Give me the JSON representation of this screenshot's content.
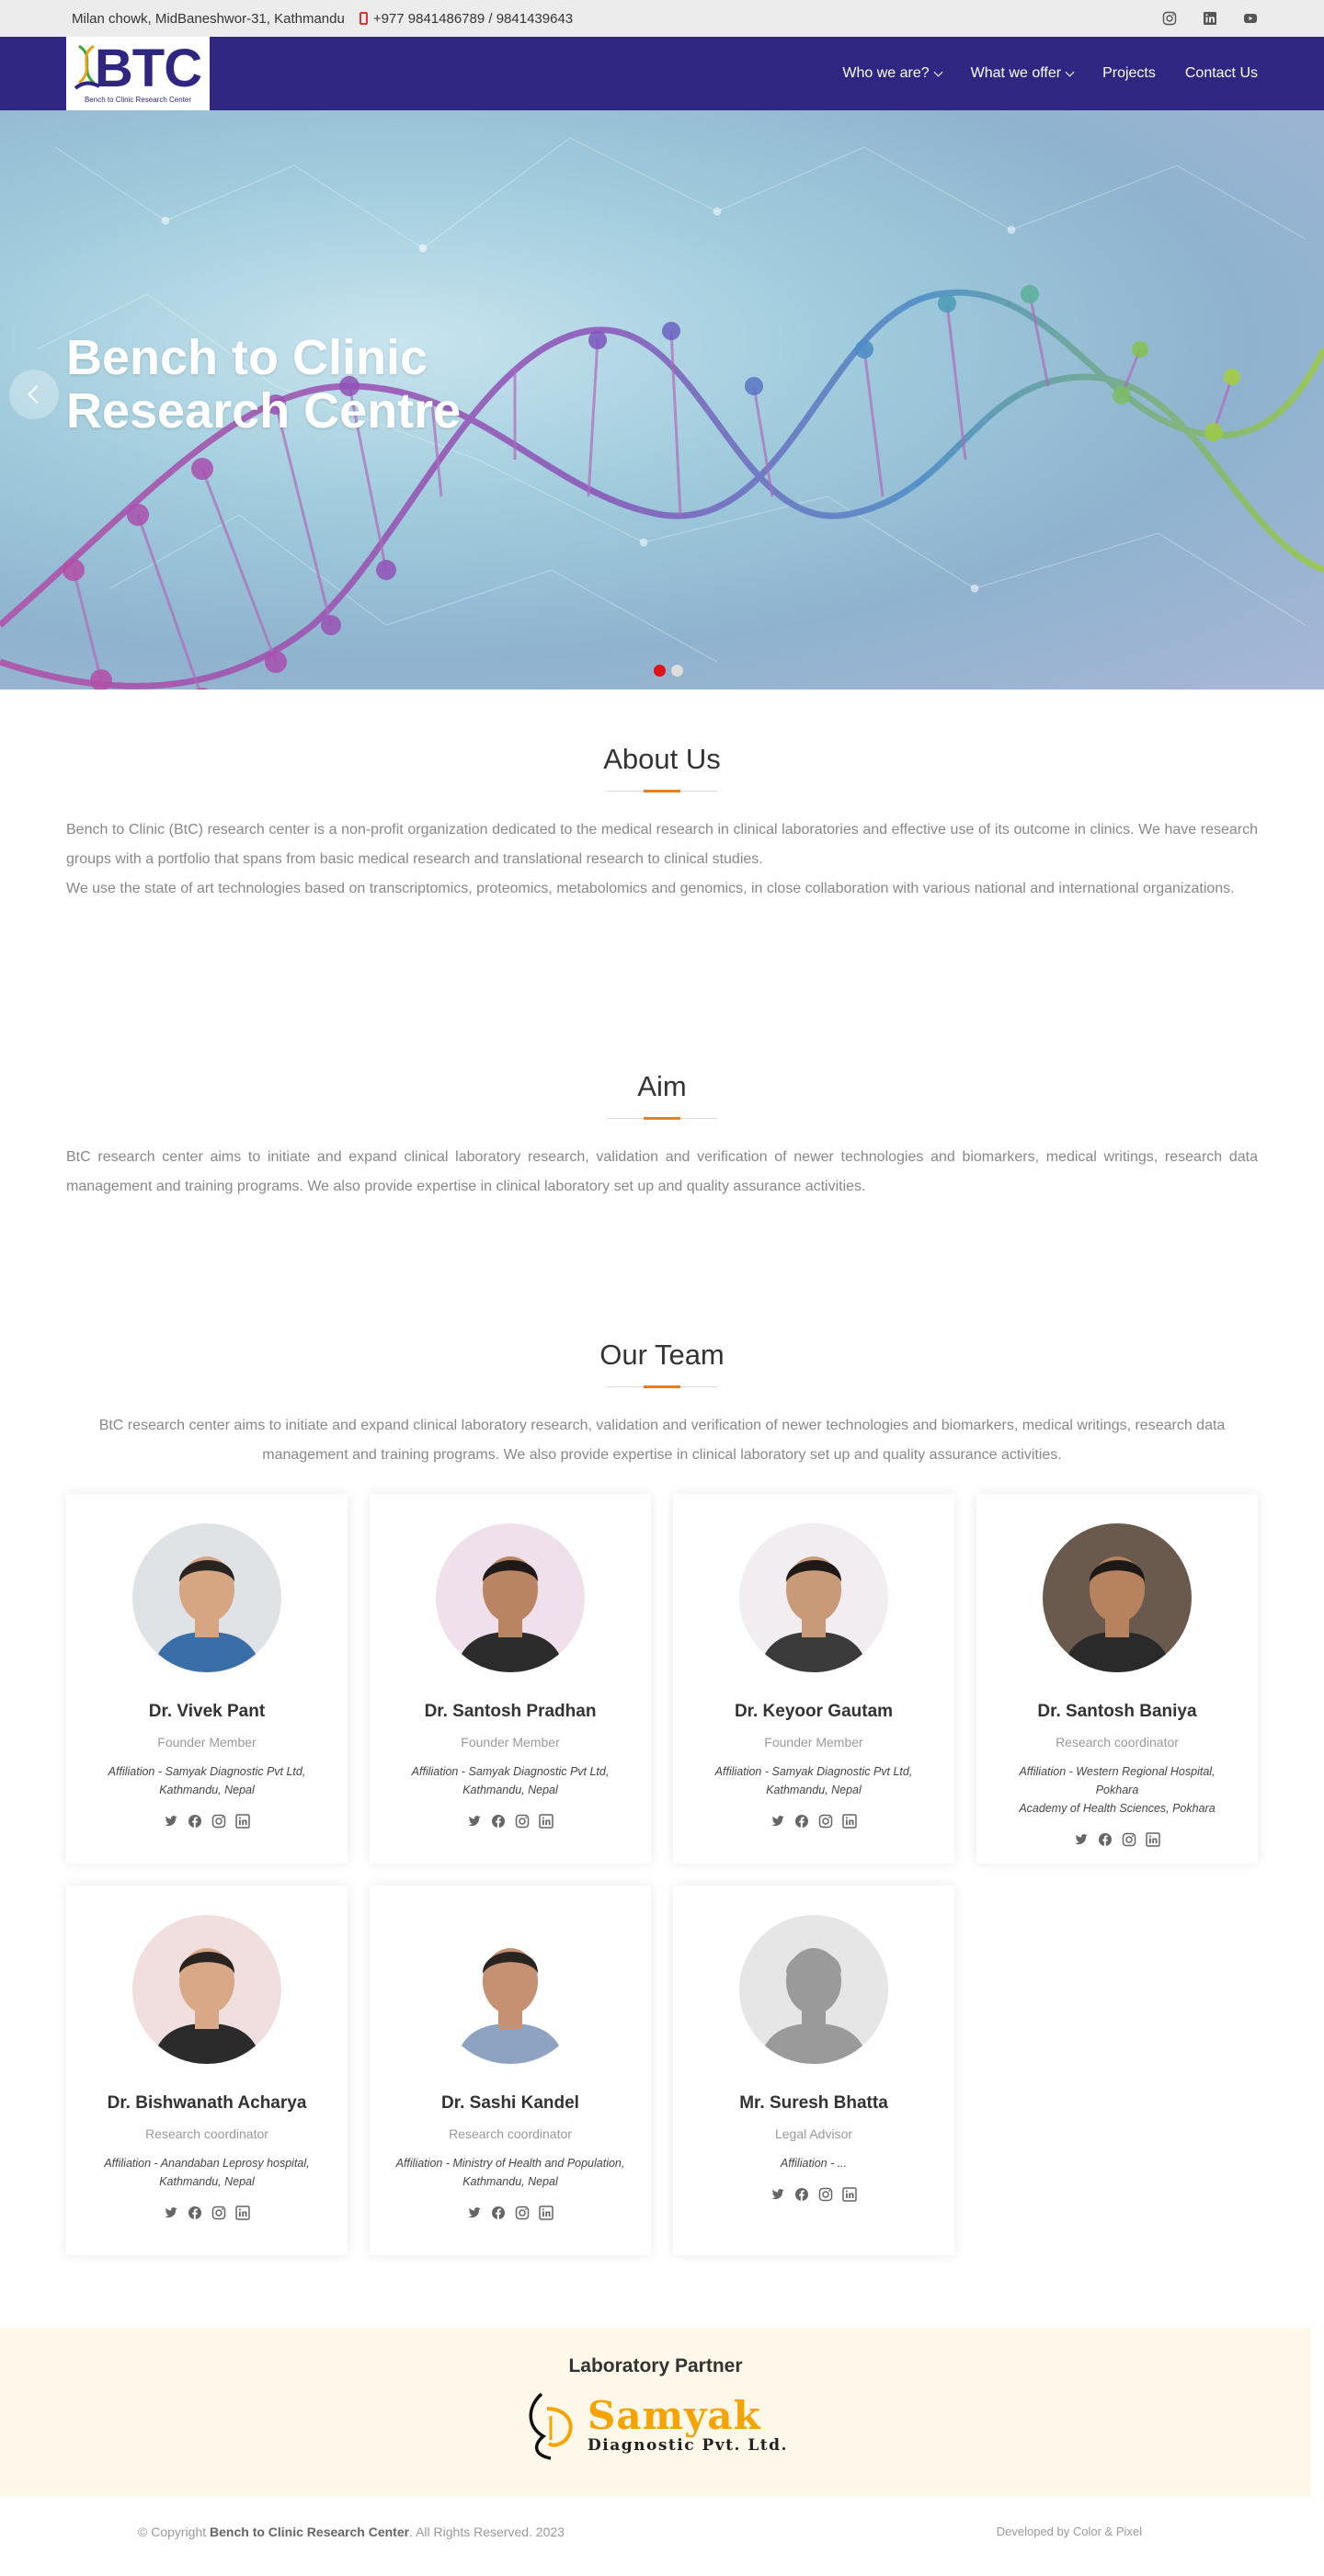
{
  "topbar": {
    "address": "Milan chowk, MidBaneshwor-31, Kathmandu",
    "phone": "+977 9841486789 / 9841439643",
    "socials": [
      "instagram-icon",
      "linkedin-icon",
      "youtube-icon"
    ]
  },
  "header": {
    "logo_text": "BTC",
    "logo_sub": "Bench to Clinic Research Center",
    "nav": [
      {
        "label": "Who we are?",
        "dropdown": true
      },
      {
        "label": "What we offer",
        "dropdown": true
      },
      {
        "label": "Projects",
        "dropdown": false
      },
      {
        "label": "Contact Us",
        "dropdown": false
      }
    ]
  },
  "hero": {
    "title_line1": "Bench to Clinic",
    "title_line2": "Research Centre",
    "active_slide": 1,
    "slide_count": 2
  },
  "about": {
    "title": "About Us",
    "p1": "Bench to Clinic (BtC) research center is a non-profit organization dedicated to the medical research in clinical laboratories and effective use of its outcome in clinics. We have research groups with a portfolio that spans from basic medical research and translational research to clinical studies.",
    "p2": "We use the state of art technologies based on transcriptomics, proteomics, metabolomics and genomics, in close collaboration with various national and international organizations."
  },
  "aim": {
    "title": "Aim",
    "text": "BtC research center aims to initiate and expand clinical laboratory research, validation and verification of newer technologies and biomarkers, medical writings, research data management and training programs. We also provide expertise in clinical laboratory set up and quality assurance activities."
  },
  "team": {
    "title": "Our Team",
    "intro": "BtC research center aims to initiate and expand clinical laboratory research, validation and verification of newer technologies and biomarkers, medical writings, research data management and training programs. We also provide expertise in clinical laboratory set up and quality assurance activities.",
    "members": [
      {
        "name": "Dr. Vivek Pant",
        "role": "Founder Member",
        "aff1": "Affiliation - Samyak Diagnostic Pvt Ltd,",
        "aff2": "Kathmandu, Nepal"
      },
      {
        "name": "Dr. Santosh Pradhan",
        "role": "Founder Member",
        "aff1": "Affiliation - Samyak Diagnostic Pvt Ltd,",
        "aff2": "Kathmandu, Nepal"
      },
      {
        "name": "Dr. Keyoor Gautam",
        "role": "Founder Member",
        "aff1": "Affiliation - Samyak Diagnostic Pvt Ltd,",
        "aff2": "Kathmandu, Nepal"
      },
      {
        "name": "Dr. Santosh Baniya",
        "role": "Research coordinator",
        "aff1": "Affiliation - Western Regional Hospital, Pokhara",
        "aff2": "Academy of Health Sciences, Pokhara"
      },
      {
        "name": "Dr. Bishwanath Acharya",
        "role": "Research coordinator",
        "aff1": "Affiliation - Anandaban Leprosy hospital,",
        "aff2": "Kathmandu, Nepal"
      },
      {
        "name": "Dr. Sashi Kandel",
        "role": "Research coordinator",
        "aff1": "Affiliation - Ministry of Health and Population,",
        "aff2": "Kathmandu, Nepal"
      },
      {
        "name": "Mr. Suresh Bhatta",
        "role": "Legal Advisor",
        "aff1": "Affiliation - ...",
        "aff2": ""
      }
    ]
  },
  "partner": {
    "title": "Laboratory Partner",
    "logo_name": "Samyak",
    "logo_sub": "Diagnostic Pvt. Ltd."
  },
  "footer": {
    "copy_prefix": "© Copyright",
    "org": "Bench to Clinic Research Center",
    "copy_suffix": ". All Rights Reserved. 2023",
    "dev": "Developed by Color & Pixel"
  }
}
